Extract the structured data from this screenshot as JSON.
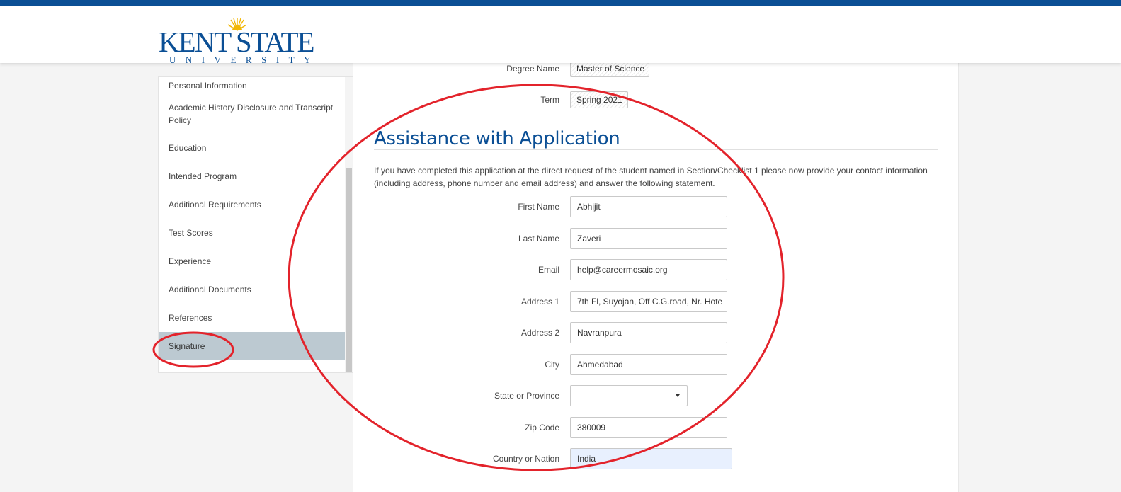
{
  "header": {
    "logo_name": "KENT STATE",
    "logo_sub": "UNIVERSITY",
    "brand_color": "#0b4f95"
  },
  "sidebar": {
    "items": [
      {
        "label": "Personal Information"
      },
      {
        "label": "Academic History Disclosure and Transcript Policy"
      },
      {
        "label": "Education"
      },
      {
        "label": "Intended Program"
      },
      {
        "label": "Additional Requirements"
      },
      {
        "label": "Test Scores"
      },
      {
        "label": "Experience"
      },
      {
        "label": "Additional Documents"
      },
      {
        "label": "References"
      },
      {
        "label": "Signature"
      }
    ],
    "active_item": "Signature"
  },
  "program": {
    "degree_label": "Degree Name",
    "degree_value": "Master of Science",
    "term_label": "Term",
    "term_value": "Spring 2021"
  },
  "assistance": {
    "title": "Assistance with Application",
    "intro": "If you have completed this application at the direct request of the student named in Section/Checklist 1 please now provide your contact information (including address, phone number and email address) and answer the following statement.",
    "fields": {
      "first_name": {
        "label": "First Name",
        "value": "Abhijit"
      },
      "last_name": {
        "label": "Last Name",
        "value": "Zaveri"
      },
      "email": {
        "label": "Email",
        "value": "help@careermosaic.org"
      },
      "address1": {
        "label": "Address 1",
        "value": "7th Fl, Suyojan, Off C.G.road, Nr. Hote"
      },
      "address2": {
        "label": "Address 2",
        "value": "Navranpura"
      },
      "city": {
        "label": "City",
        "value": "Ahmedabad"
      },
      "state": {
        "label": "State or Province",
        "value": ""
      },
      "zip": {
        "label": "Zip Code",
        "value": "380009"
      },
      "country": {
        "label": "Country or Nation",
        "value": "India"
      }
    }
  },
  "annotation_color": "#e3232b"
}
